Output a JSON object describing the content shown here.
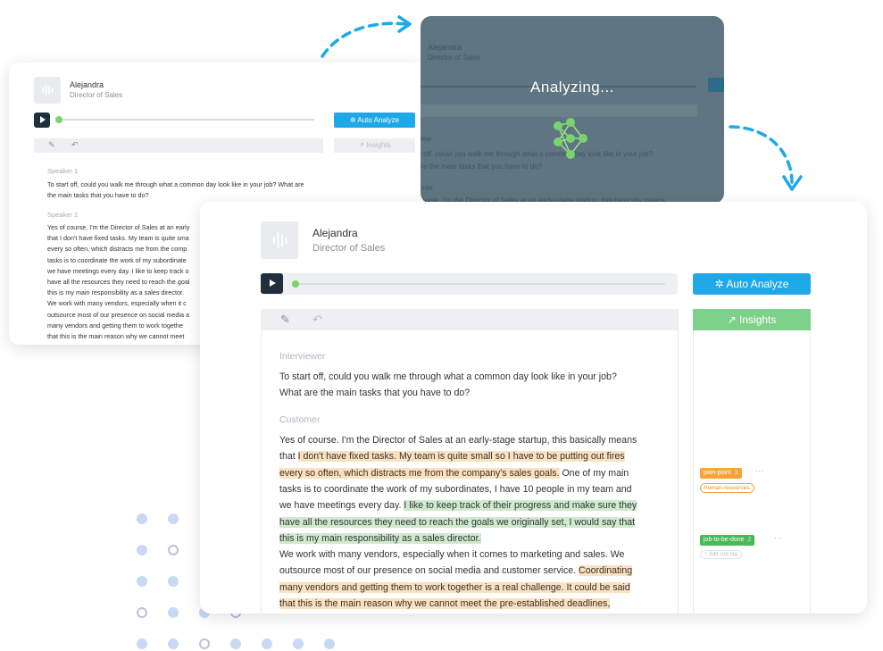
{
  "back_card": {
    "user_name": "Alejandra",
    "user_role": "Director of Sales",
    "auto_analyze_label": "Auto Analyze",
    "insights_label": "Insights",
    "speaker1": "Speaker 1",
    "speaker1_text": "To start off, could you walk me through what a common day look like in your job? What are the main tasks that you have to do?",
    "speaker2": "Speaker 2",
    "speaker2_lines": [
      "Yes of course.  I'm the Director of Sales at an early",
      "that I don't have fixed tasks. My team is quite sma",
      "every so often, which distracts me from the comp",
      "tasks is to coordinate the work of my subordinate",
      "we have meetings every day. I like to keep track o",
      "have all the resources they need to reach the goal",
      "this is my main responsibility as a sales director.",
      "We work with many vendors, especially when it c",
      "outsource most of our presence on social media a",
      "many vendors and getting them to work togethe",
      "that this is the main reason why we cannot meet"
    ]
  },
  "analyzing_card": {
    "status_label": "Analyzing...",
    "user_name": "Alejandra",
    "user_role": "Director of Sales",
    "ghost_lines": [
      "view",
      "rt off, could you walk me through what a common day look like in your job?",
      "are the main tasks that you have to do?",
      "omer",
      "course.  I'm the Director of Sales at an early-stage startup, this basically means"
    ]
  },
  "front_card": {
    "user_name": "Alejandra",
    "user_role": "Director of Sales",
    "auto_analyze_label": "Auto Analyze",
    "insights_label": "Insights",
    "interviewer_label": "Interviewer",
    "interviewer_lines": [
      "To start off, could you walk me through what a common day look like in your job?",
      "What are the main tasks that you have to do?"
    ],
    "customer_label": "Customer",
    "customer_lines": [
      [
        {
          "t": "Yes of course.  I'm the Director of Sales at an early-stage startup, this basically means",
          "h": ""
        }
      ],
      [
        {
          "t": "that ",
          "h": ""
        },
        {
          "t": "I don't have fixed tasks. My team is quite small so I have to be putting out fires",
          "h": "o"
        }
      ],
      [
        {
          "t": "every so often, which distracts me from the company's sales goals.",
          "h": "o"
        },
        {
          "t": " One of my main",
          "h": ""
        }
      ],
      [
        {
          "t": "tasks is to coordinate the work of my subordinates, I have 10 people in my team and",
          "h": ""
        }
      ],
      [
        {
          "t": "we have meetings every day. ",
          "h": ""
        },
        {
          "t": "I like to keep track of their progress and make sure they",
          "h": "g"
        }
      ],
      [
        {
          "t": "have all the resources they need to reach the goals we originally set, I would say that",
          "h": "g"
        }
      ],
      [
        {
          "t": "this is my main responsibility as a sales director.",
          "h": "g"
        }
      ],
      [
        {
          "t": "We work with many vendors, especially when it comes to marketing and sales. We",
          "h": ""
        }
      ],
      [
        {
          "t": "outsource most of our presence on social media and customer service. ",
          "h": ""
        },
        {
          "t": "Coordinating",
          "h": "o"
        }
      ],
      [
        {
          "t": "many vendors and getting them to work together is a real challenge. It could be said",
          "h": "o"
        }
      ],
      [
        {
          "t": "that this is the main reason why we cannot meet the pre-established deadlines,",
          "h": "o"
        }
      ]
    ],
    "tags": {
      "pain_point": {
        "label": "pain-point",
        "count": "3",
        "color": "#f5a33a"
      },
      "human_resources": {
        "label": "human-resources"
      },
      "job_to_be_done": {
        "label": "job-to-be-done",
        "count": "2",
        "color": "#49b857"
      },
      "add_sub_tag": {
        "label": "+ Add sub tag"
      }
    }
  },
  "colors": {
    "accent_blue": "#1fa8e8",
    "insights_green": "#7ed18a",
    "highlight_orange": "#fce1bf",
    "highlight_green": "#cfeacf",
    "dark_button": "#1f2f3d"
  }
}
